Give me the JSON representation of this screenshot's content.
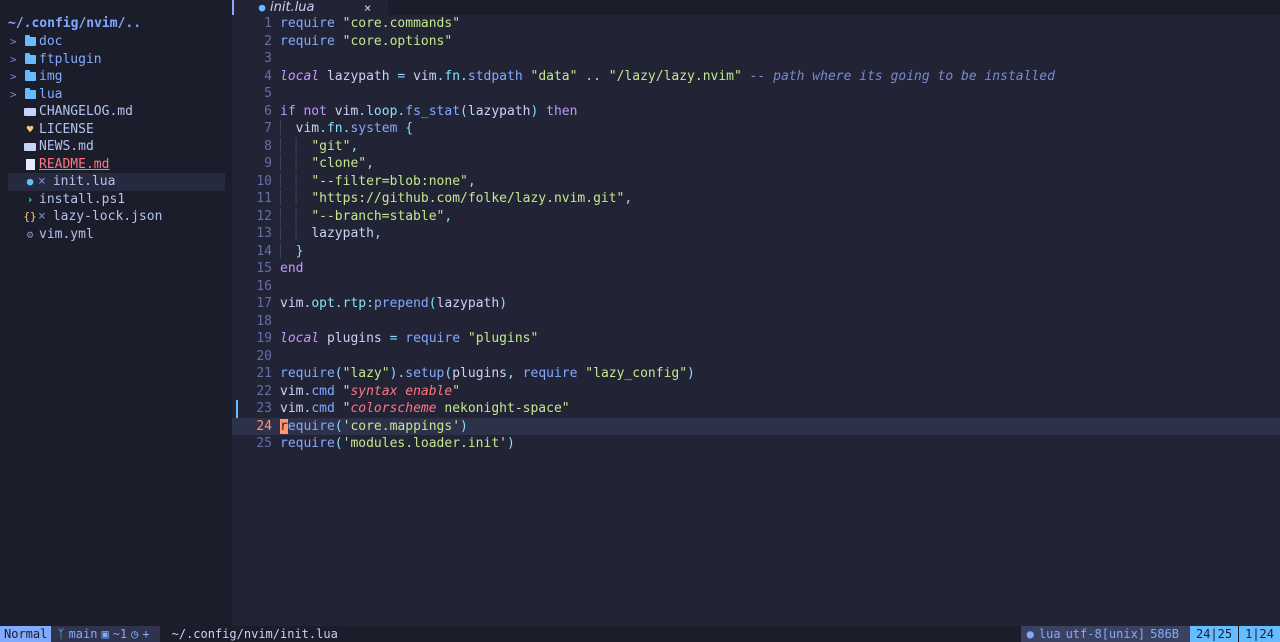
{
  "sidebar": {
    "title": "~/.config/nvim/..",
    "items": [
      {
        "type": "dir",
        "label": "doc",
        "icon": "folder-icon"
      },
      {
        "type": "dir",
        "label": "ftplugin",
        "icon": "folder-icon"
      },
      {
        "type": "dir",
        "label": "img",
        "icon": "folder-icon"
      },
      {
        "type": "dir",
        "label": "lua",
        "icon": "folder-icon"
      },
      {
        "type": "file",
        "label": "CHANGELOG.md",
        "icon": "markdown-icon"
      },
      {
        "type": "file",
        "label": "LICENSE",
        "icon": "license-icon"
      },
      {
        "type": "file",
        "label": "NEWS.md",
        "icon": "markdown-icon"
      },
      {
        "type": "file",
        "label": "README.md",
        "icon": "readme-icon"
      },
      {
        "type": "file",
        "label": "init.lua",
        "icon": "lua-icon",
        "modified": true
      },
      {
        "type": "file",
        "label": "install.ps1",
        "icon": "powershell-icon"
      },
      {
        "type": "file",
        "label": "lazy-lock.json",
        "icon": "json-icon",
        "modified": true
      },
      {
        "type": "file",
        "label": "vim.yml",
        "icon": "gear-icon"
      }
    ]
  },
  "tab": {
    "label": "init.lua",
    "close": "×"
  },
  "editor": {
    "line_numbers": [
      "1",
      "2",
      "3",
      "4",
      "5",
      "6",
      "7",
      "8",
      "9",
      "10",
      "11",
      "12",
      "13",
      "14",
      "15",
      "16",
      "17",
      "18",
      "19",
      "20",
      "21",
      "22",
      "23",
      "24",
      "25"
    ],
    "current_line": 24,
    "t": {
      "require": "require",
      "local": "local",
      "if": "if",
      "not": "not",
      "then": "then",
      "end": "end",
      "vim": "vim",
      "fn": "fn",
      "loop": "loop",
      "opt": "opt",
      "rtp": "rtp",
      "cmd": "cmd",
      "lazypath": "lazypath",
      "plugins": "plugins",
      "s_core_commands": "\"core.commands\"",
      "s_core_options": "\"core.options\"",
      "stdpath": "stdpath",
      "s_data": "\"data\"",
      "concat": "..",
      "s_lazy_path": "\"/lazy/lazy.nvim\"",
      "comment": "-- path where its going to be installed",
      "fs_stat": "fs_stat",
      "system": "system",
      "s_git": "\"git\"",
      "s_clone": "\"clone\"",
      "s_filter": "\"--filter=blob:none\"",
      "s_url": "\"https://github.com/folke/lazy.nvim.git\"",
      "s_branch": "\"--branch=stable\"",
      "prepend": "prepend",
      "s_plugins": "\"plugins\"",
      "s_lazy": "\"lazy\"",
      "setup": "setup",
      "s_lazy_config": "\"lazy_config\"",
      "syntax_enable": "syntax enable",
      "colorscheme": "colorscheme",
      "nekonight": " nekonight-space",
      "cursor_char": "r",
      "equire": "equire",
      "s_core_mappings": "'core.mappings'",
      "s_modules_loader": "'modules.loader.init'"
    }
  },
  "statusline": {
    "mode": "Normal",
    "branch": "main",
    "diff": "~1",
    "diagnostics": "+",
    "filepath": "~/.config/nvim/init.lua",
    "filetype": "lua",
    "encoding": "utf-8[unix]",
    "filesize": "586B",
    "position": "24|25",
    "column": "1|24"
  },
  "colors": {
    "background": "#222436",
    "sidebar": "#1b1d2b",
    "accent": "#82aaff",
    "string": "#c3e88d",
    "keyword": "#c099ff",
    "cursor": "#ff966c"
  }
}
